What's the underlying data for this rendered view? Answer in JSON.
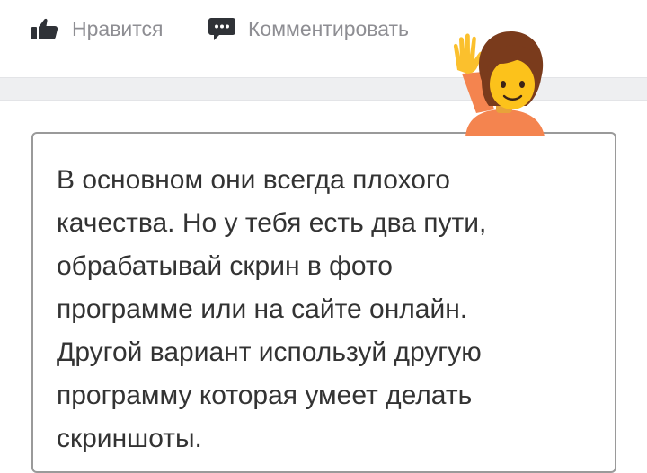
{
  "actions": {
    "like_label": "Нравится",
    "comment_label": "Комментировать"
  },
  "reply": {
    "text": "В основном они всегда плохого\nкачества. Но у тебя есть два пути,\nобрабатывай скрин в фото\nпрограмме или на сайте онлайн.\nДругой вариант используй другую\nпрограмму которая умеет делать\nскриншоты."
  },
  "icons": {
    "like": "thumbs-up-icon",
    "comment": "comment-icon",
    "emoji": "person-raising-hand-emoji"
  },
  "colors": {
    "action_text": "#8e8e93",
    "icon_dark": "#2f3237",
    "separator": "#eeeff1",
    "text": "#333333",
    "border": "#9a9a9a"
  }
}
